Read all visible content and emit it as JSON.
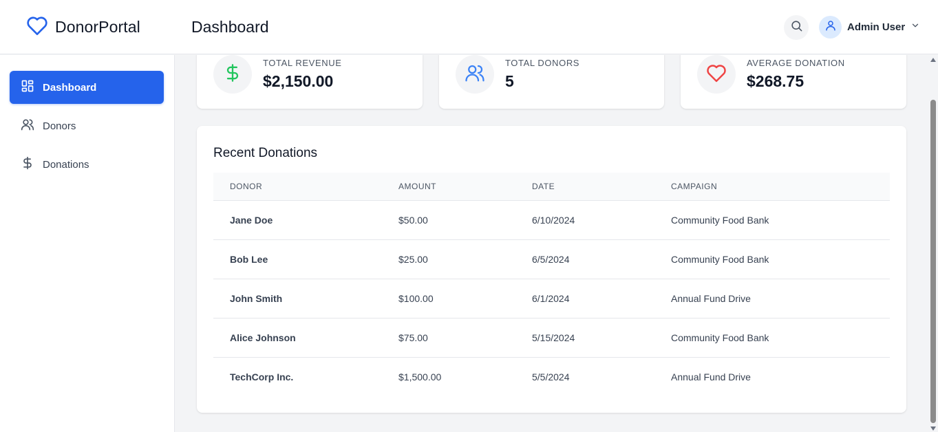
{
  "brand": {
    "name": "DonorPortal"
  },
  "header": {
    "title": "Dashboard",
    "user_name": "Admin User"
  },
  "sidebar": {
    "items": [
      {
        "label": "Dashboard",
        "icon": "grid-icon"
      },
      {
        "label": "Donors",
        "icon": "users-icon"
      },
      {
        "label": "Donations",
        "icon": "dollar-icon"
      }
    ]
  },
  "stats": [
    {
      "label": "Total Revenue",
      "value": "$2,150.00",
      "icon": "dollar-icon",
      "color": "#22c55e"
    },
    {
      "label": "Total Donors",
      "value": "5",
      "icon": "users-icon",
      "color": "#3b82f6"
    },
    {
      "label": "Average Donation",
      "value": "$268.75",
      "icon": "heart-icon",
      "color": "#ef4444"
    }
  ],
  "recent": {
    "title": "Recent Donations",
    "columns": [
      "DONOR",
      "AMOUNT",
      "DATE",
      "CAMPAIGN"
    ],
    "rows": [
      {
        "donor": "Jane Doe",
        "amount": "$50.00",
        "date": "6/10/2024",
        "campaign": "Community Food Bank"
      },
      {
        "donor": "Bob Lee",
        "amount": "$25.00",
        "date": "6/5/2024",
        "campaign": "Community Food Bank"
      },
      {
        "donor": "John Smith",
        "amount": "$100.00",
        "date": "6/1/2024",
        "campaign": "Annual Fund Drive"
      },
      {
        "donor": "Alice Johnson",
        "amount": "$75.00",
        "date": "5/15/2024",
        "campaign": "Community Food Bank"
      },
      {
        "donor": "TechCorp Inc.",
        "amount": "$1,500.00",
        "date": "5/5/2024",
        "campaign": "Annual Fund Drive"
      }
    ]
  },
  "colors": {
    "accent": "#2563eb",
    "link": "#1d4ed8"
  }
}
